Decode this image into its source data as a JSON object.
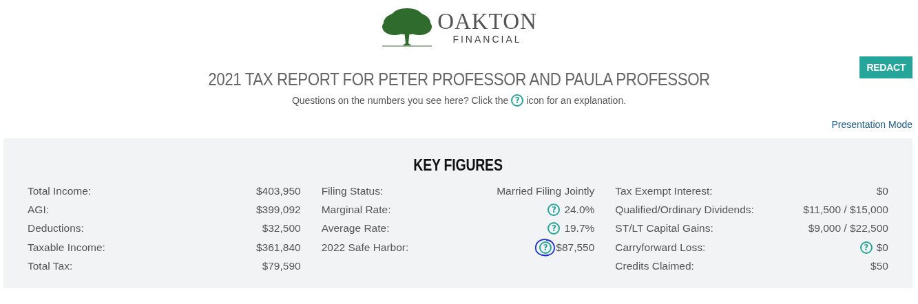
{
  "logo": {
    "name": "OAKTON",
    "tagline": "FINANCIAL"
  },
  "title": "2021 TAX REPORT FOR PETER PROFESSOR AND PAULA PROFESSOR",
  "redact_button": "REDACT",
  "subtitle": {
    "before": "Questions on the numbers you see here? Click the",
    "icon": "?",
    "after": "icon for an explanation."
  },
  "presentation_link": "Presentation Mode",
  "key_figures": {
    "heading": "KEY FIGURES",
    "columns": [
      [
        {
          "label": "Total Income:",
          "value": "$403,950"
        },
        {
          "label": "AGI:",
          "value": "$399,092"
        },
        {
          "label": "Deductions:",
          "value": "$32,500"
        },
        {
          "label": "Taxable Income:",
          "value": "$361,840"
        },
        {
          "label": "Total Tax:",
          "value": "$79,590"
        }
      ],
      [
        {
          "label": "Filing Status:",
          "value": "Married Filing Jointly"
        },
        {
          "label": "Marginal Rate:",
          "value": "24.0%",
          "help": "?"
        },
        {
          "label": "Average Rate:",
          "value": "19.7%",
          "help": "?"
        },
        {
          "label": "2022 Safe Harbor:",
          "value": "$87,550",
          "help": "?",
          "circled": true
        }
      ],
      [
        {
          "label": "Tax Exempt Interest:",
          "value": "$0"
        },
        {
          "label": "Qualified/Ordinary Dividends:",
          "value": "$11,500 / $15,000"
        },
        {
          "label": "ST/LT Capital Gains:",
          "value": "$9,000 / $22,500"
        },
        {
          "label": "Carryforward Loss:",
          "value": "$0",
          "help": "?"
        },
        {
          "label": "Credits Claimed:",
          "value": "$50"
        }
      ]
    ]
  }
}
